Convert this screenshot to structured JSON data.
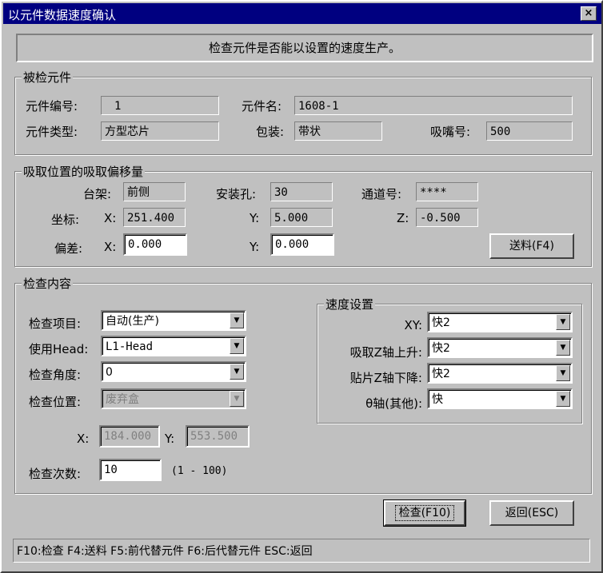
{
  "window": {
    "title": "以元件数据速度确认",
    "close_label": "×"
  },
  "banner": "检查元件是否能以设置的速度生产。",
  "component": {
    "legend": "被检元件",
    "id_label": "元件编号:",
    "id_value": "1",
    "name_label": "元件名:",
    "name_value": "1608-1",
    "type_label": "元件类型:",
    "type_value": "方型芯片",
    "pack_label": "包装:",
    "pack_value": "带状",
    "nozzle_label": "吸嘴号:",
    "nozzle_value": "500"
  },
  "offset": {
    "legend": "吸取位置的吸取偏移量",
    "rack_label": "台架:",
    "rack_value": "前侧",
    "hole_label": "安装孔:",
    "hole_value": "30",
    "channel_label": "通道号:",
    "channel_value": "****",
    "coord_label": "坐标:",
    "x_label": "X:",
    "x_value": "251.400",
    "y_label": "Y:",
    "y_value": "5.000",
    "z_label": "Z:",
    "z_value": "-0.500",
    "dev_label": "偏差:",
    "dev_x_label": "X:",
    "dev_x_value": "0.000",
    "dev_y_label": "Y:",
    "dev_y_value": "0.000",
    "feed_button": "送料(F4)"
  },
  "check": {
    "legend": "检查内容",
    "item_label": "检查项目:",
    "item_value": "自动(生产)",
    "head_label": "使用Head:",
    "head_value": "L1-Head",
    "angle_label": "检查角度:",
    "angle_value": "0",
    "pos_label": "检查位置:",
    "pos_value": "废弃盒",
    "pos_x_label": "X:",
    "pos_x_value": "184.000",
    "pos_y_label": "Y:",
    "pos_y_value": "553.500",
    "count_label": "检查次数:",
    "count_value": "10",
    "count_range": "(1 - 100)"
  },
  "speed": {
    "legend": "速度设置",
    "xy_label": "XY:",
    "xy_value": "快2",
    "pickz_label": "吸取Z轴上升:",
    "pickz_value": "快2",
    "placez_label": "贴片Z轴下降:",
    "placez_value": "快2",
    "theta_label": "θ轴(其他):",
    "theta_value": "快"
  },
  "buttons": {
    "check": "检查(F10)",
    "back": "返回(ESC)"
  },
  "status": "F10:检查  F4:送料  F5:前代替元件  F6:后代替元件  ESC:返回"
}
